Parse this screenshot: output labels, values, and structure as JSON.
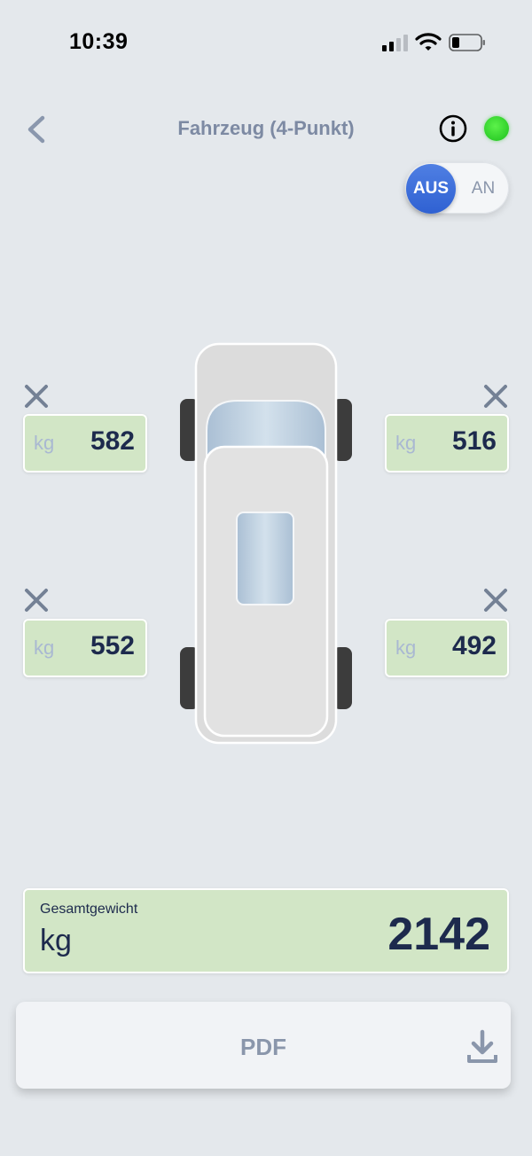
{
  "status_bar": {
    "time": "10:39"
  },
  "header": {
    "title": "Fahrzeug (4-Punkt)"
  },
  "toggle": {
    "off_label": "AUS",
    "on_label": "AN",
    "selected": "AUS"
  },
  "wheels": {
    "front_left": {
      "unit": "kg",
      "value": "582"
    },
    "front_right": {
      "unit": "kg",
      "value": "516"
    },
    "rear_left": {
      "unit": "kg",
      "value": "552"
    },
    "rear_right": {
      "unit": "kg",
      "value": "492"
    }
  },
  "total": {
    "label": "Gesamtgewicht",
    "unit": "kg",
    "value": "2142"
  },
  "pdf_button": {
    "label": "PDF"
  },
  "icons": [
    "back-chevron-icon",
    "info-icon",
    "status-led-icon",
    "remove-icon",
    "download-icon",
    "signal-icon",
    "wifi-icon",
    "battery-icon"
  ],
  "colors": {
    "accent": "#2f61d2",
    "status_led": "#2fcf2a",
    "weight_box": "#d2e6c6",
    "value_text": "#1d2a4d"
  }
}
